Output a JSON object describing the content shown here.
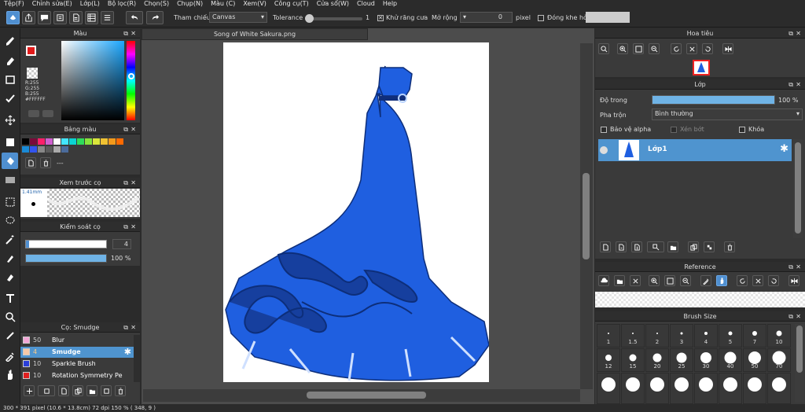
{
  "menu": [
    "Tệp(F)",
    "Chỉnh sửa(E)",
    "Lớp(L)",
    "Bộ lọc(R)",
    "Chọn(S)",
    "Chụp(N)",
    "Màu (C)",
    "Xem(V)",
    "Công cụ(T)",
    "Cửa sổ(W)",
    "Cloud",
    "Help"
  ],
  "toolbar": {
    "ref_label": "Tham chiếu",
    "ref_value": "Canvas",
    "tolerance_label": "Tolerance",
    "tolerance_value": "1",
    "antialias_label": "Khử răng cưa",
    "expand_label": "Mở rộng",
    "expand_value": "0",
    "expand_unit": "pixel",
    "close_gap_label": "Đóng khe hở"
  },
  "color_panel": {
    "title": "Màu",
    "r": "R:255",
    "g": "G:255",
    "b": "B:255",
    "hex": "#FFFFFF",
    "fg": "#e21b1b",
    "bg": "#ffffff"
  },
  "palette_panel": {
    "title": "Bảng màu",
    "field": "---",
    "colors": [
      "#000000",
      "#7a0a3a",
      "#ff1f6a",
      "#d05fcf",
      "#ffffff",
      "#43e5ff",
      "#0bd3d3",
      "#2ddc5b",
      "#86e33c",
      "#d9e63b",
      "#f1c232",
      "#f49a1b",
      "#ff6a00",
      "#1a8ad6",
      "#3355ee",
      "#888888",
      "#5b5b5b",
      "#aaaaaa",
      "#4b6b9b"
    ]
  },
  "preview_panel": {
    "title": "Xem trước cọ",
    "size": "1.41mm"
  },
  "control_panel": {
    "title": "Kiểm soát cọ",
    "size_value": "4",
    "opacity_value": "100 %",
    "opacity": 1.0
  },
  "brush_panel": {
    "title": "Cọ: Smudge",
    "items": [
      {
        "size": "50",
        "name": "Blur",
        "color": "#f2a6d6"
      },
      {
        "size": "4",
        "name": "Smudge",
        "color": "#f5c8a8"
      },
      {
        "size": "10",
        "name": "Sparkle Brush",
        "color": "#2a3fd8"
      },
      {
        "size": "10",
        "name": "Rotation Symmetry Pe",
        "color": "#e02020"
      }
    ]
  },
  "canvas_tab": "Song of White Sakura.png",
  "navigator": {
    "title": "Hoa tiêu"
  },
  "layer_panel": {
    "title": "Lớp",
    "opacity_label": "Độ trong",
    "opacity_value": "100 %",
    "opacity": 1.0,
    "blend_label": "Pha trộn",
    "blend_value": "Bình thường",
    "protect_alpha": "Bảo vệ alpha",
    "clipping": "Xén bớt",
    "lock": "Khóa",
    "layer_name": "Lớp1"
  },
  "reference_panel": {
    "title": "Reference"
  },
  "brushsize_panel": {
    "title": "Brush Size",
    "sizes": [
      "1",
      "1.5",
      "2",
      "3",
      "4",
      "5",
      "7",
      "10",
      "12",
      "15",
      "20",
      "25",
      "30",
      "40",
      "50",
      "70"
    ]
  },
  "status": "300 * 391 pixel  (10.6 * 13.8cm)  72 dpi  150 %  ( 348, 9 )"
}
